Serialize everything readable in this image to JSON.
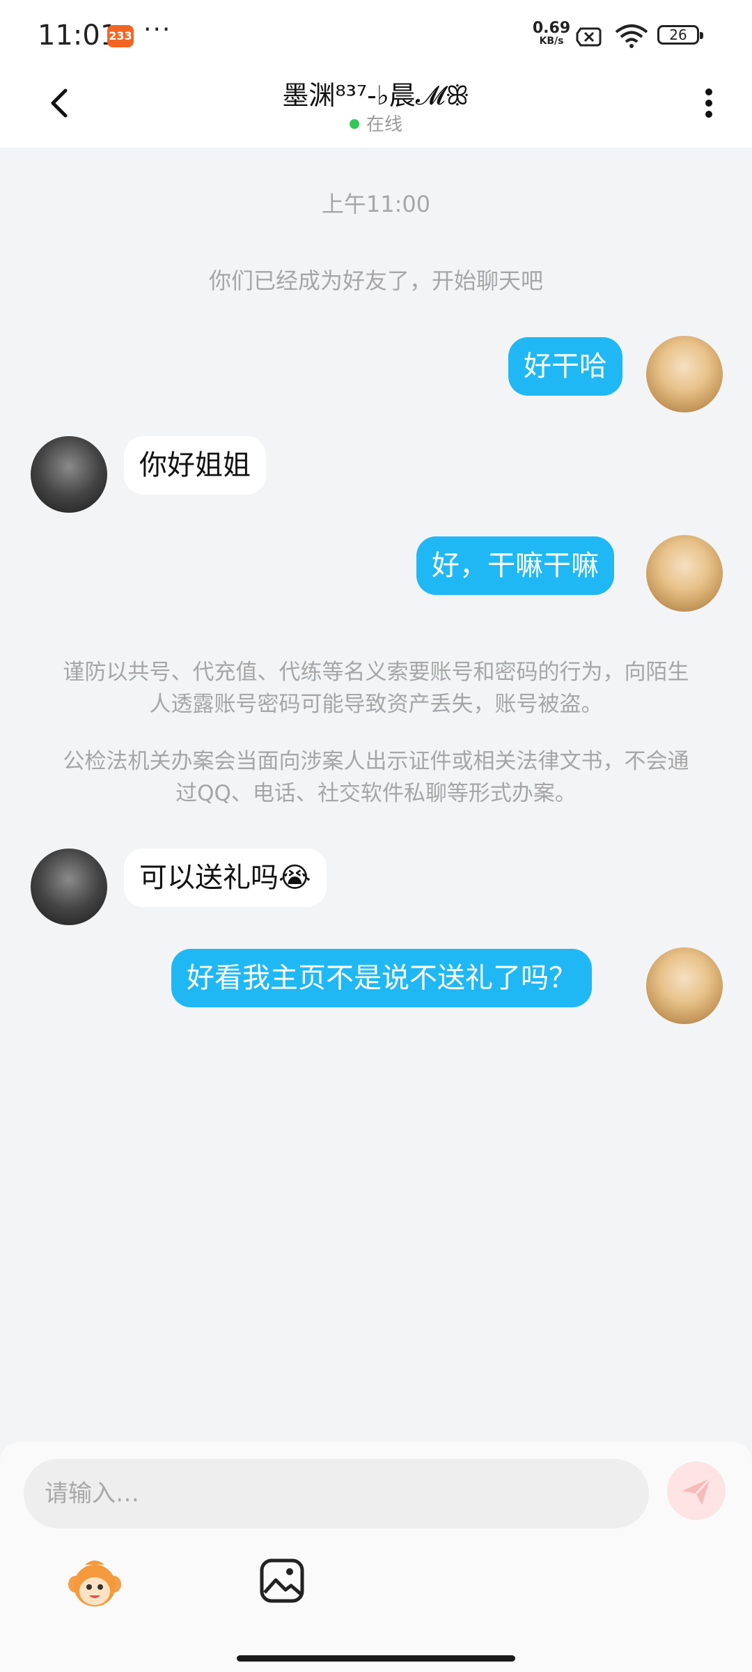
{
  "status_bar": {
    "time": "11:01",
    "badge": "233",
    "more": "···",
    "net_speed_value": "0.69",
    "net_speed_unit": "KB/s",
    "battery": "26"
  },
  "header": {
    "title": "墨渊⁸³⁷-♭晨𝓜ꕥ",
    "status": "在线"
  },
  "chat": {
    "timestamp": "上午11:00",
    "friend_tip": "你们已经成为好友了，开始聊天吧",
    "messages": [
      {
        "from": "me",
        "text": "好干哈"
      },
      {
        "from": "other",
        "text": "你好姐姐"
      },
      {
        "from": "me",
        "text": "好，干嘛干嘛"
      },
      {
        "from": "other",
        "text": "可以送礼吗😭"
      },
      {
        "from": "me",
        "text": "好看我主页不是说不送礼了吗？"
      }
    ],
    "warning_1": "谨防以共号、代充值、代练等名义索要账号和密码的行为，向陌生人透露账号密码可能导致资产丢失，账号被盗。",
    "warning_2": "公检法机关办案会当面向涉案人出示证件或相关法律文书，不会通过QQ、电话、社交软件私聊等形式办案。"
  },
  "input": {
    "placeholder": "请输入…"
  },
  "colors": {
    "bubble_me": "#20b8f4",
    "bubble_other": "#ffffff",
    "online_dot": "#34c759",
    "send_button": "#fde3e3"
  }
}
